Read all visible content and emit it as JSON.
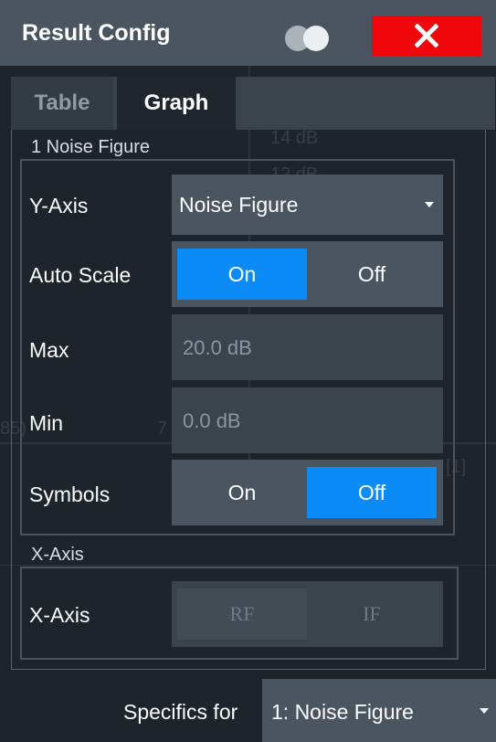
{
  "titlebar": {
    "title": "Result Config",
    "toggle_icon": "display-toggle-icon",
    "close_icon": "close-icon",
    "close_color": "#f0060b"
  },
  "tabs": [
    {
      "label": "Table",
      "active": false
    },
    {
      "label": "Graph",
      "active": true
    }
  ],
  "noise_figure_section": {
    "label": "1 Noise Figure",
    "y_axis": {
      "label": "Y-Axis",
      "value": "Noise Figure"
    },
    "auto_scale": {
      "label": "Auto Scale",
      "on_label": "On",
      "off_label": "Off",
      "selected": "On"
    },
    "max": {
      "label": "Max",
      "value": "20.0 dB"
    },
    "min": {
      "label": "Min",
      "value": "0.0 dB"
    },
    "symbols": {
      "label": "Symbols",
      "on_label": "On",
      "off_label": "Off",
      "selected": "Off"
    }
  },
  "x_axis_section": {
    "label": "X-Axis",
    "x_axis": {
      "label": "X-Axis",
      "rf_label": "RF",
      "if_label": "IF",
      "selected": "RF"
    }
  },
  "footer": {
    "specifics_label": "Specifics for",
    "specifics_value": "1: Noise Figure"
  },
  "colors": {
    "accent": "#0b8bf6",
    "titlebar": "#4b555f",
    "background": "#1e242b"
  }
}
